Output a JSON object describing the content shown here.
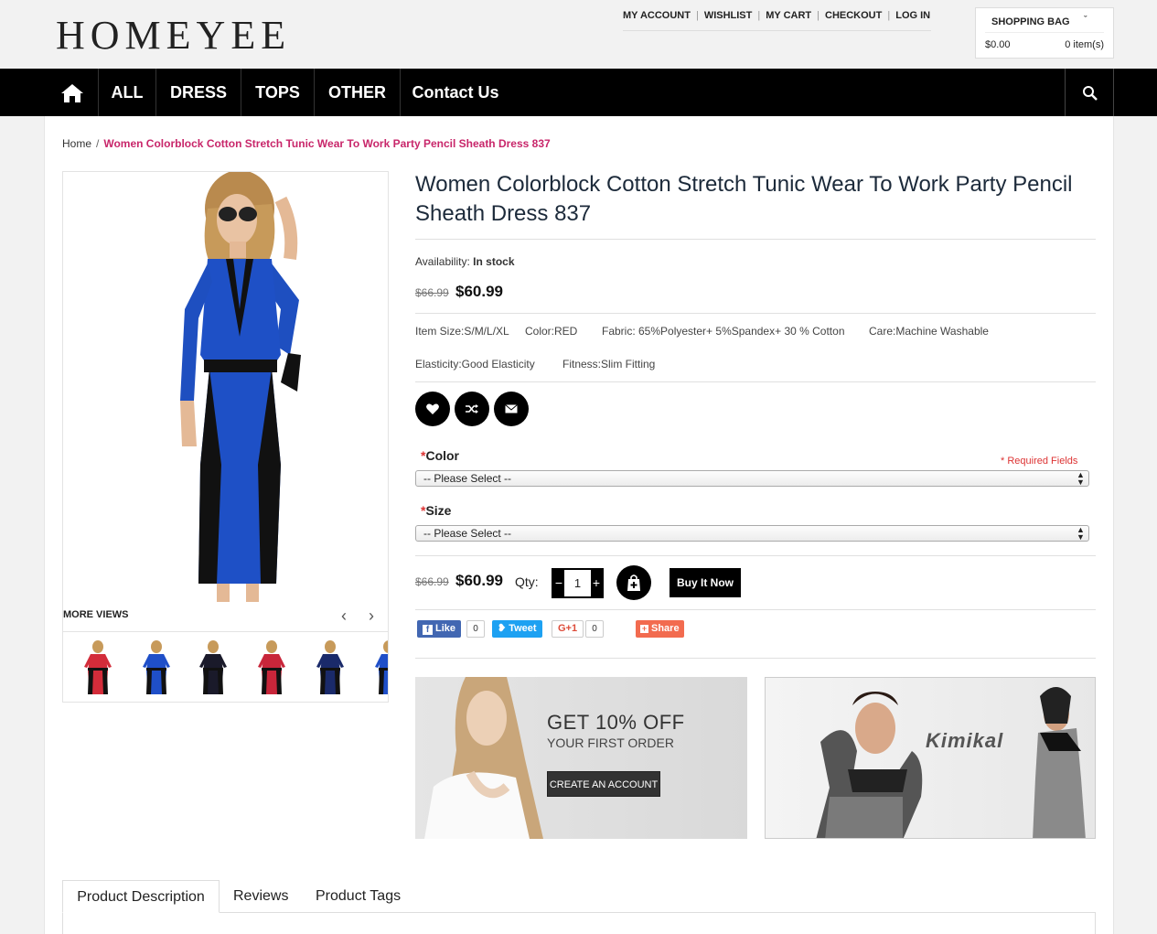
{
  "header": {
    "logo": "HOMEYEE",
    "top_links": [
      "MY ACCOUNT",
      "WISHLIST",
      "MY CART",
      "CHECKOUT",
      "LOG IN"
    ],
    "bag": {
      "title": "SHOPPING BAG",
      "caret": "ˇ",
      "total": "$0.00",
      "items": "0 item(s)"
    }
  },
  "nav": {
    "home_icon": "home-icon",
    "items": [
      "ALL",
      "DRESS",
      "TOPS",
      "OTHER",
      "Contact Us"
    ],
    "search_icon": "search-icon"
  },
  "breadcrumb": {
    "home": "Home",
    "separator": "/",
    "current": "Women Colorblock Cotton Stretch Tunic Wear To Work Party Pencil Sheath Dress 837"
  },
  "gallery": {
    "more_views": "MORE VIEWS",
    "prev": "‹",
    "next": "›",
    "thumb_colors": [
      "#d32c3a",
      "#1f4fc8",
      "#1a1a2a",
      "#c8263a",
      "#1a2a6a",
      "#1f4fc8"
    ]
  },
  "product": {
    "title": "Women Colorblock Cotton Stretch Tunic Wear To Work Party Pencil Sheath Dress 837",
    "availability_label": "Availability:",
    "availability_value": "In stock",
    "old_price": "$66.99",
    "price": "$60.99",
    "specs": {
      "size": "Item Size:S/M/L/XL",
      "color": "Color:RED",
      "fabric": "Fabric: 65%Polyester+ 5%Spandex+ 30 % Cotton",
      "care": "Care:Machine Washable",
      "elasticity": "Elasticity:Good Elasticity",
      "fitness": "Fitness:Slim Fitting"
    },
    "action_icons": [
      "heart-icon",
      "shuffle-icon",
      "envelope-icon"
    ],
    "required_note": "* Required Fields",
    "color_field": {
      "asterisk": "*",
      "label": "Color",
      "value": "-- Please Select --"
    },
    "size_field": {
      "asterisk": "*",
      "label": "Size",
      "value": "-- Please Select --"
    },
    "qty_label": "Qty:",
    "qty_value": "1",
    "qty_minus": "−",
    "qty_plus": "+",
    "buy_now": "Buy It Now"
  },
  "social": {
    "like": "Like",
    "like_count": "0",
    "tweet": "Tweet",
    "gplus": "G+1",
    "gplus_count": "0",
    "share": "Share"
  },
  "promo": {
    "headline": "GET 10% OFF",
    "subline": "YOUR FIRST ORDER",
    "button": "CREATE AN ACCOUNT",
    "brand": "Kimikal"
  },
  "tabs": [
    "Product Description",
    "Reviews",
    "Product Tags"
  ]
}
